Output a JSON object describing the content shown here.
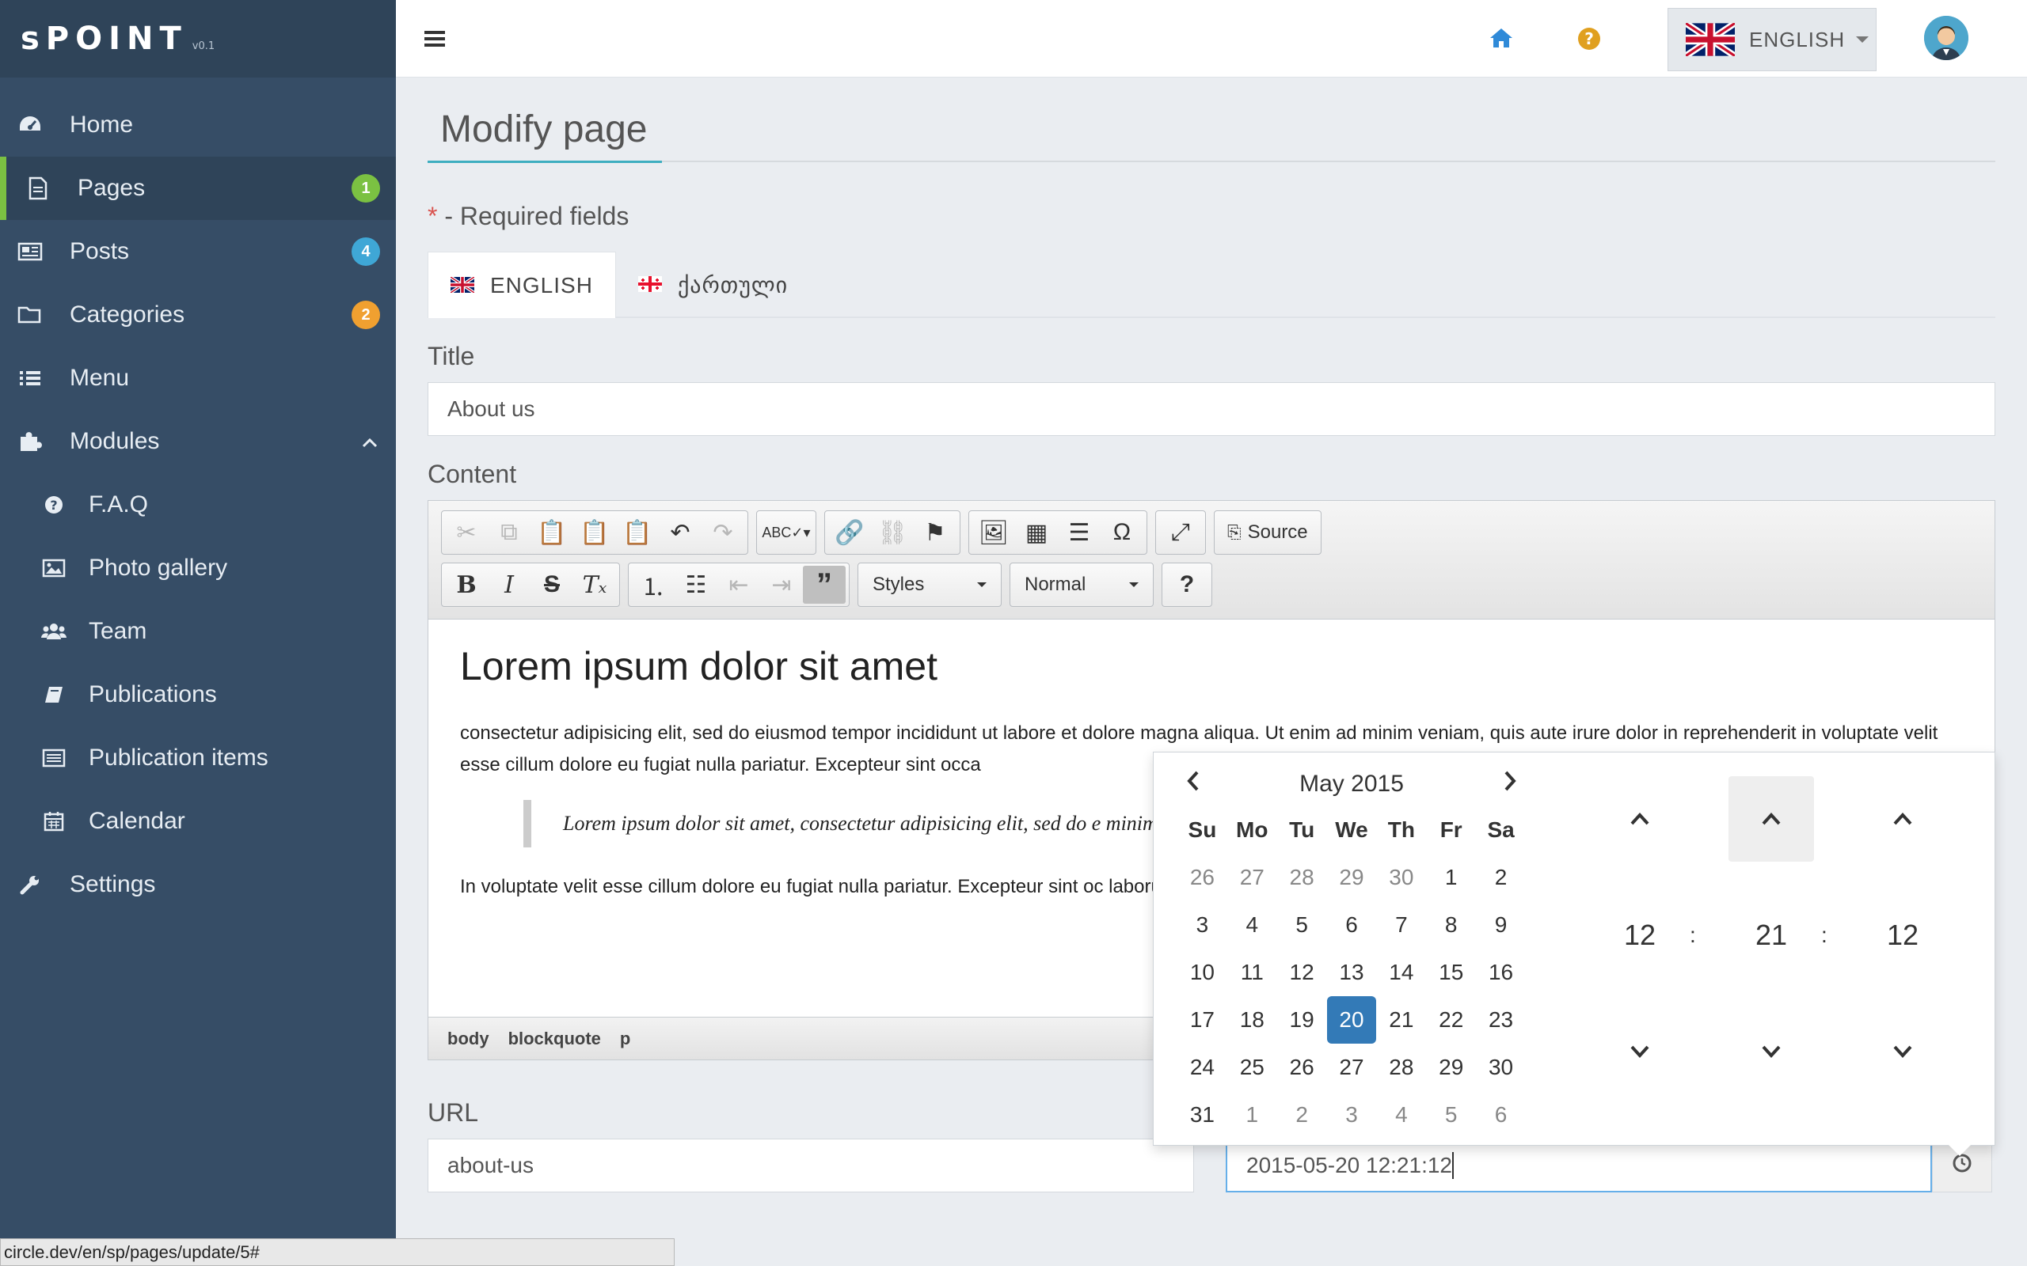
{
  "app": {
    "logo": "sPOINT",
    "version": "v0.1"
  },
  "sidebar": {
    "items": [
      {
        "label": "Home",
        "icon": "dashboard-icon"
      },
      {
        "label": "Pages",
        "icon": "file-icon",
        "badge": "1",
        "active": true
      },
      {
        "label": "Posts",
        "icon": "newspaper-icon",
        "badge": "4"
      },
      {
        "label": "Categories",
        "icon": "folder-icon",
        "badge": "2"
      },
      {
        "label": "Menu",
        "icon": "list-icon"
      },
      {
        "label": "Modules",
        "icon": "puzzle-icon"
      }
    ],
    "modules": [
      {
        "label": "F.A.Q",
        "icon": "question-icon"
      },
      {
        "label": "Photo gallery",
        "icon": "image-icon"
      },
      {
        "label": "Team",
        "icon": "users-icon"
      },
      {
        "label": "Publications",
        "icon": "book-icon"
      },
      {
        "label": "Publication items",
        "icon": "list-alt-icon"
      },
      {
        "label": "Calendar",
        "icon": "calendar-icon"
      }
    ],
    "settings": {
      "label": "Settings",
      "icon": "wrench-icon"
    },
    "badge_colors": {
      "pages": "#7bc142",
      "posts": "#3fa7d6",
      "categories": "#f0a030"
    }
  },
  "topbar": {
    "language": "ENGLISH"
  },
  "page": {
    "title": "Modify page",
    "required_star": "*",
    "required_text": "- Required fields",
    "tabs": [
      "ENGLISH",
      "ქართული"
    ],
    "title_label": "Title",
    "title_value": "About us",
    "content_label": "Content",
    "url_label": "URL",
    "url_value": "about-us",
    "date_value": "2015-05-20 12:21:12"
  },
  "editor": {
    "source_label": "Source",
    "styles_label": "Styles",
    "format_label": "Normal",
    "heading": "Lorem ipsum dolor sit amet",
    "para1": "consectetur adipisicing elit, sed do eiusmod tempor incididunt ut labore et dolore magna aliqua. Ut enim ad minim veniam, quis aute irure dolor in reprehenderit in voluptate velit esse cillum dolore eu fugiat nulla pariatur. Excepteur sint occa",
    "quote": "Lorem ipsum dolor sit amet, consectetur adipisicing elit, sed do e minim veniam, quis nostrud exercitation ullamco laboris nisi ut",
    "para2": "In voluptate velit esse cillum dolore eu fugiat nulla pariatur. Excepteur sint oc laborum Lorem ipsum dolor sit amet, consectetur adipisicing elit, sed do eius",
    "path": [
      "body",
      "blockquote",
      "p"
    ]
  },
  "datepicker": {
    "month": "May 2015",
    "dow": [
      "Su",
      "Mo",
      "Tu",
      "We",
      "Th",
      "Fr",
      "Sa"
    ],
    "days": [
      "26",
      "27",
      "28",
      "29",
      "30",
      "1",
      "2",
      "3",
      "4",
      "5",
      "6",
      "7",
      "8",
      "9",
      "10",
      "11",
      "12",
      "13",
      "14",
      "15",
      "16",
      "17",
      "18",
      "19",
      "20",
      "21",
      "22",
      "23",
      "24",
      "25",
      "26",
      "27",
      "28",
      "29",
      "30",
      "31",
      "1",
      "2",
      "3",
      "4",
      "5",
      "6"
    ],
    "hour": "12",
    "minute": "21",
    "second": "12",
    "sep": ":"
  },
  "status_url": "circle.dev/en/sp/pages/update/5#"
}
